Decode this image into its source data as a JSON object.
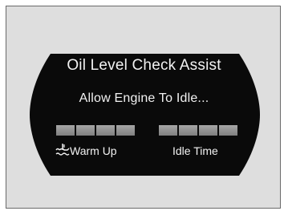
{
  "display": {
    "title": "Oil Level Check Assist",
    "message": "Allow Engine To Idle...",
    "warm_up": {
      "label": "Warm Up",
      "icon": "oil-temperature-icon",
      "segments": 4,
      "progress": 0
    },
    "idle_time": {
      "label": "Idle Time",
      "segments": 4,
      "progress": 0
    }
  }
}
